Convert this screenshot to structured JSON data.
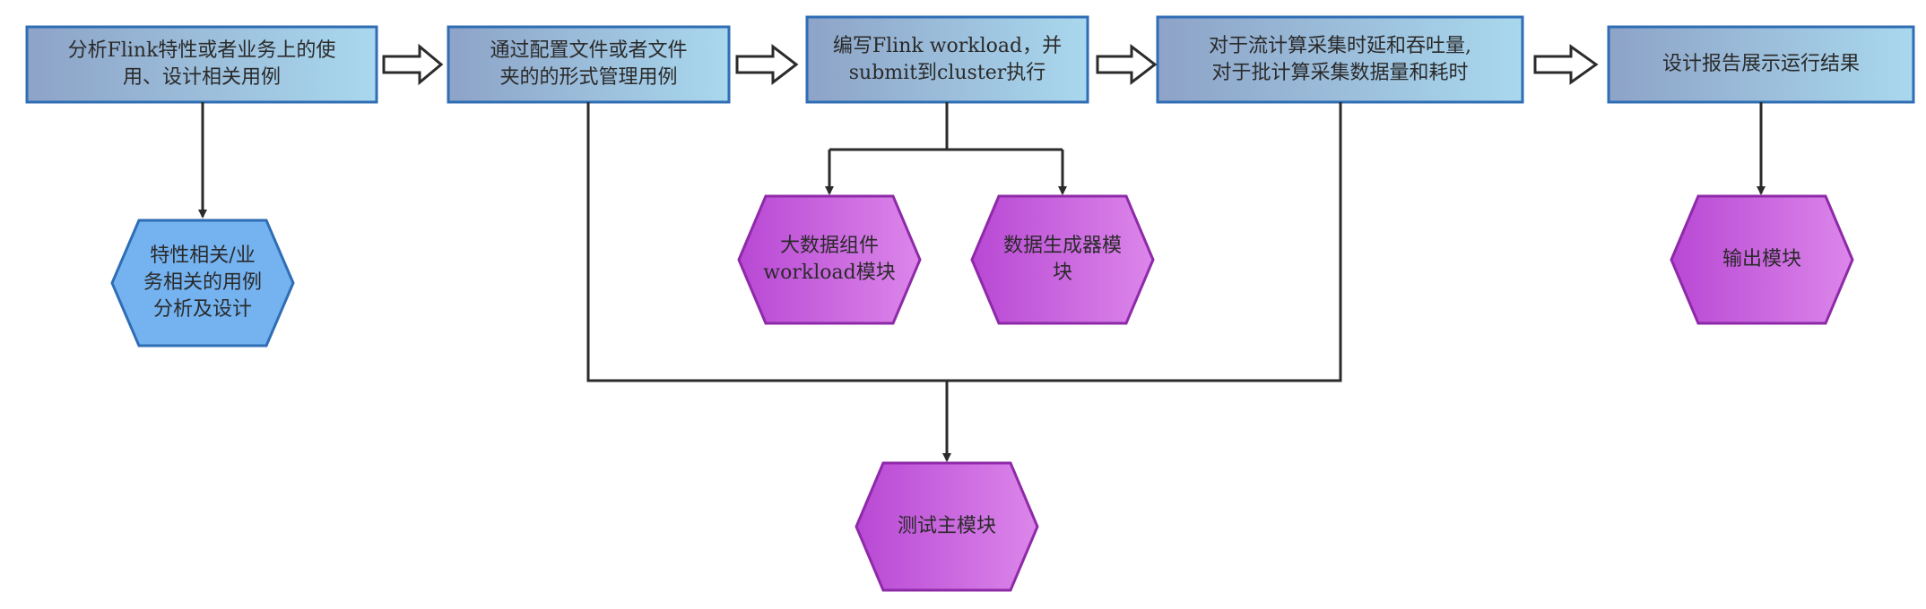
{
  "steps": [
    {
      "label": "分析Flink特性或者业务上的使\n用、设计相关用例"
    },
    {
      "label": "通过配置文件或者文件\n夹的的形式管理用例"
    },
    {
      "label": "编写Flink workload，并\nsubmit到cluster执行"
    },
    {
      "label": "对于流计算采集时延和吞吐量,\n对于批计算采集数据量和耗时"
    },
    {
      "label": "设计报告展示运行结果"
    }
  ],
  "modules": {
    "case_design": "特性相关/业\n务相关的用例\n分析及设计",
    "bigdata_workload": "大数据组件\nworkload模块",
    "data_generator": "数据生成器模\n块",
    "output": "输出模块",
    "test_main": "测试主模块"
  },
  "colors": {
    "step_fill_left": "#8da3c7",
    "step_fill_right": "#a9d8ee",
    "step_border": "#2f6db5",
    "hex_purple_left": "#b848d4",
    "hex_purple_right": "#dc86ea",
    "hex_purple_border": "#8e2aa8",
    "hex_blue_fill": "#74b3f0",
    "hex_blue_border": "#2f6db5",
    "connector": "#2b2b2b"
  }
}
